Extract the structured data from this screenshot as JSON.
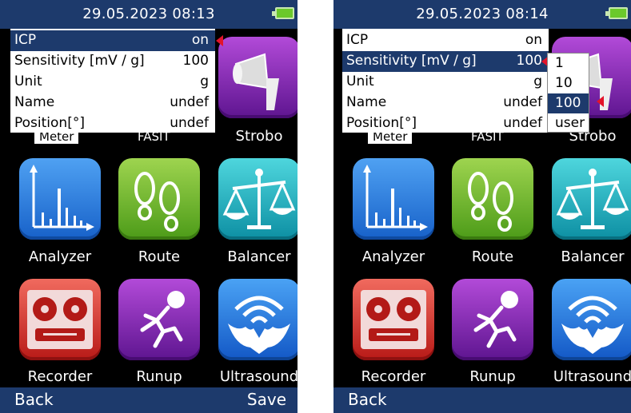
{
  "left_screen": {
    "datetime": "29.05.2023 08:13",
    "menu": {
      "items": [
        {
          "label": "ICP",
          "value": "on"
        },
        {
          "label": "Sensitivity [mV / g]",
          "value": "100"
        },
        {
          "label": "Unit",
          "value": "g"
        },
        {
          "label": "Name",
          "value": "undef"
        },
        {
          "label": "Position[°]",
          "value": "undef"
        }
      ]
    },
    "meter_label": "Meter",
    "fasit_label": "FASIT",
    "strobo_label": "Strobo",
    "apps": [
      "Analyzer",
      "Route",
      "Balancer",
      "Recorder",
      "Runup",
      "Ultrasound"
    ],
    "back_label": "Back",
    "save_label": "Save"
  },
  "right_screen": {
    "datetime": "29.05.2023 08:14",
    "menu": {
      "items": [
        {
          "label": "ICP",
          "value": "on"
        },
        {
          "label": "Sensitivity [mV / g]",
          "value": "100"
        },
        {
          "label": "Unit",
          "value": "g"
        },
        {
          "label": "Name",
          "value": "undef"
        },
        {
          "label": "Position[°]",
          "value": "undef"
        }
      ]
    },
    "meter_label": "Meter",
    "fasit_label": "FASIT",
    "strobo_label": "Strobo",
    "apps": [
      "Analyzer",
      "Route",
      "Balancer",
      "Recorder",
      "Runup",
      "Ultrasound"
    ],
    "submenu": [
      "1",
      "10",
      "100",
      "user"
    ],
    "back_label": "Back"
  },
  "colors": {
    "bar": "#1d3a6c",
    "marker": "#e3142a",
    "battery": "#6bc92b"
  }
}
